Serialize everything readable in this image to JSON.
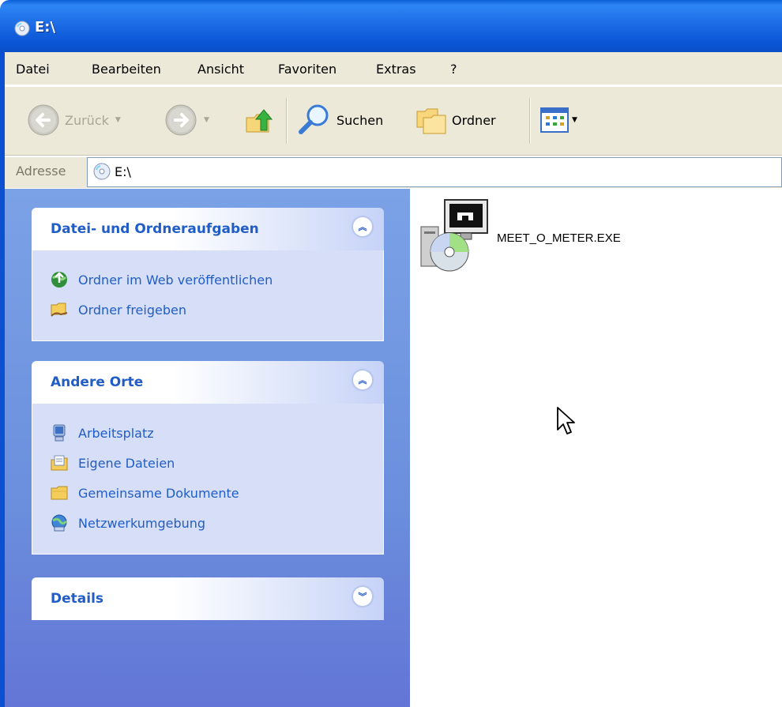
{
  "window": {
    "title": "E:\\"
  },
  "menubar": {
    "items": [
      "Datei",
      "Bearbeiten",
      "Ansicht",
      "Favoriten",
      "Extras",
      "?"
    ]
  },
  "toolbar": {
    "back_label": "Zurück",
    "search_label": "Suchen",
    "folders_label": "Ordner"
  },
  "address": {
    "label": "Adresse",
    "value": "E:\\"
  },
  "taskpane": {
    "file_tasks": {
      "title": "Datei- und Ordneraufgaben",
      "items": [
        {
          "label": "Ordner im Web veröffentlichen",
          "icon": "publish-web-icon"
        },
        {
          "label": "Ordner freigeben",
          "icon": "share-folder-icon"
        }
      ]
    },
    "other_places": {
      "title": "Andere Orte",
      "items": [
        {
          "label": "Arbeitsplatz",
          "icon": "my-computer-icon"
        },
        {
          "label": "Eigene Dateien",
          "icon": "my-documents-icon"
        },
        {
          "label": "Gemeinsame Dokumente",
          "icon": "shared-documents-icon"
        },
        {
          "label": "Netzwerkumgebung",
          "icon": "network-places-icon"
        }
      ]
    },
    "details": {
      "title": "Details"
    }
  },
  "content": {
    "files": [
      {
        "name": "MEET_O_METER.EXE",
        "icon": "setup-exe-icon"
      }
    ]
  },
  "colors": {
    "titlebar": "#0b56d6",
    "chrome": "#ece9d8",
    "taskpane": "#7ba2e7",
    "link": "#215dc6"
  }
}
